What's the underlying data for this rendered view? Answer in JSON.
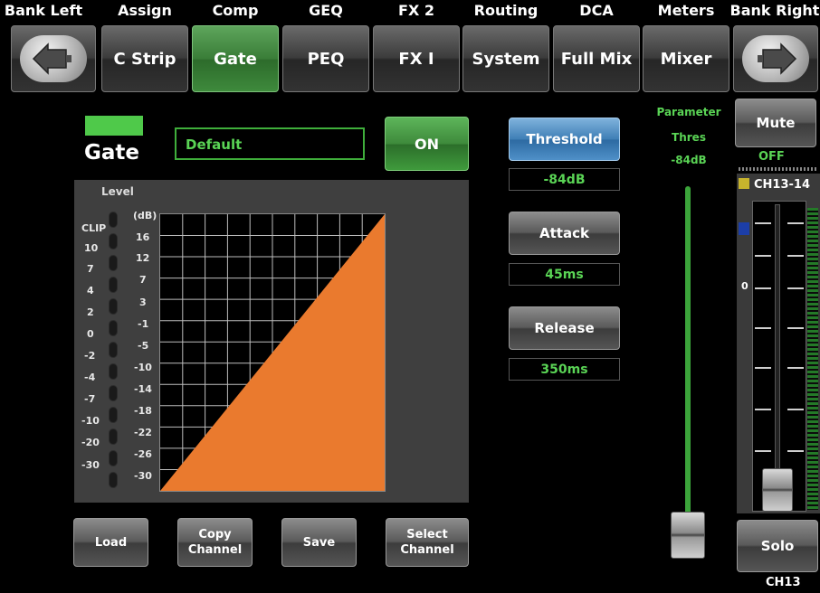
{
  "top_labels": [
    "Bank Left",
    "Assign",
    "Comp",
    "GEQ",
    "FX 2",
    "Routing",
    "DCA",
    "Meters",
    "Bank Right"
  ],
  "top_buttons": {
    "bank_left_icon": "bank-left-arrow-icon",
    "c_strip": "C Strip",
    "gate": "Gate",
    "peq": "PEQ",
    "fx1": "FX I",
    "system": "System",
    "full_mix": "Full Mix",
    "mixer": "Mixer",
    "bank_right_icon": "bank-right-arrow-icon",
    "active": "Gate"
  },
  "gate": {
    "title": "Gate",
    "preset_name": "Default",
    "on_label": "ON",
    "indicator_color": "#4fc94a"
  },
  "graph": {
    "level_title": "Level",
    "meter_scale": [
      "CLIP",
      "10",
      "7",
      "4",
      "2",
      "0",
      "-2",
      "-4",
      "-7",
      "-10",
      "-20",
      "-30"
    ],
    "db_unit": "(dB)",
    "db_scale": [
      "16",
      "12",
      "7",
      "3",
      "-1",
      "-5",
      "-10",
      "-14",
      "-18",
      "-22",
      "-26",
      "-30"
    ],
    "fill_color": "#ea7a2e"
  },
  "params": {
    "threshold_label": "Threshold",
    "threshold_value": "-84dB",
    "attack_label": "Attack",
    "attack_value": "45ms",
    "release_label": "Release",
    "release_value": "350ms",
    "active": "Threshold"
  },
  "parameter_fader": {
    "title": "Parameter",
    "name": "Thres",
    "value": "-84dB"
  },
  "channel": {
    "mute_label": "Mute",
    "mute_state": "OFF",
    "strip_name": "CH13-14",
    "zero_mark": "0",
    "solo_label": "Solo",
    "footer_name": "CH13"
  },
  "bottom_buttons": {
    "load": "Load",
    "copy_channel": "Copy\nChannel",
    "save": "Save",
    "select_channel": "Select\nChannel"
  }
}
